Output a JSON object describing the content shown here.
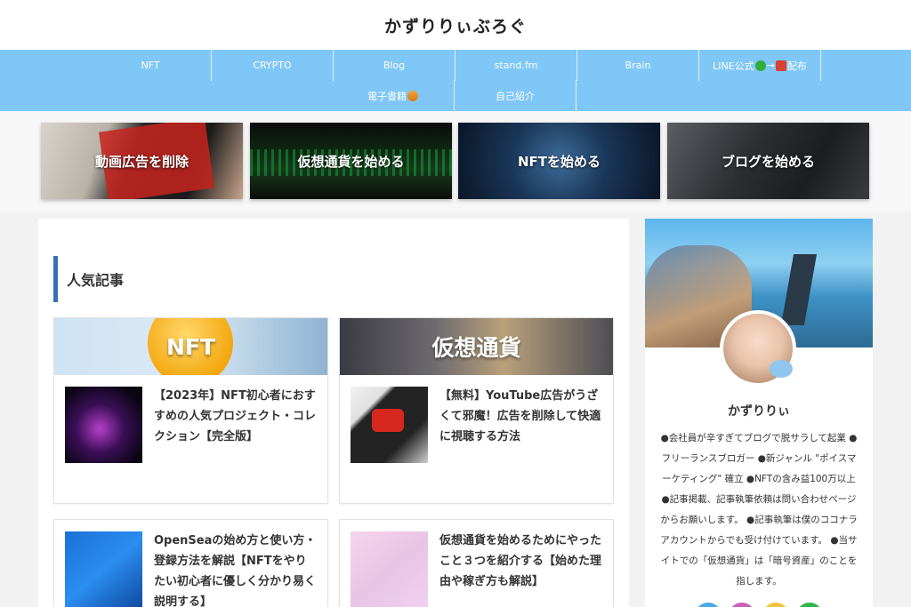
{
  "header": {
    "title": "かずりりぃぶろぐ"
  },
  "nav": {
    "row1": [
      {
        "label": "NFT"
      },
      {
        "label": "CRYPTO"
      },
      {
        "label": "Blog"
      },
      {
        "label": "stand.fm"
      },
      {
        "label": "Brain"
      },
      {
        "label_pre": "LINE公式",
        "label_post": "→",
        "label_end": "配布"
      }
    ],
    "row2": [
      {
        "label": "電子書籍"
      },
      {
        "label": "自己紹介"
      }
    ]
  },
  "banners": [
    {
      "label": "動画広告を削除"
    },
    {
      "label": "仮想通貨を始める"
    },
    {
      "label": "NFTを始める"
    },
    {
      "label": "ブログを始める"
    }
  ],
  "main": {
    "section_title": "人気記事",
    "articles": [
      {
        "category": "NFT",
        "title": "【2023年】NFT初心者におすすめの人気プロジェクト・コレクション【完全版】"
      },
      {
        "category": "仮想通貨",
        "title": "【無料】YouTube広告がうざくて邪魔！広告を削除して快適に視聴する方法"
      },
      {
        "title": "OpenSeaの始め方と使い方・登録方法を解説【NFTをやりたい初心者に優しく分かり易く説明する】"
      },
      {
        "title": "仮想通貨を始めるためにやったこと３つを紹介する【始めた理由や稼ぎ方も解説】"
      }
    ]
  },
  "sidebar": {
    "name": "かずりりぃ",
    "bio": "●会社員が辛すぎてブログで脱サラして起業 ●フリーランスブロガー ●新ジャンル \"ポイスマーケティング\" 確立 ●NFTの含み益100万以上 ●記事掲載、記事執筆依頼は問い合わせページからお願いします。 ●記事執筆は僕のココナラアカウントからでも受け付けています。 ●当サイトでの「仮想通貨」は「暗号資産」のことを指します。",
    "social_colors": [
      "#4aa8e8",
      "#c561b8",
      "#f0c43a",
      "#2fb54a"
    ]
  },
  "colors": {
    "nav_bg": "#7fc7f6",
    "heading_accent": "#3d6db6"
  }
}
